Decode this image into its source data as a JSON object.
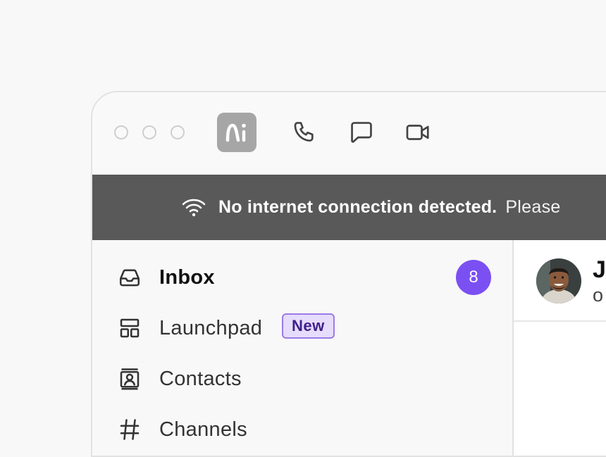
{
  "window": {
    "controls": [
      "close",
      "minimize",
      "maximize"
    ]
  },
  "toolbar": {
    "logo_icon": "app-logo",
    "icons": [
      "phone-icon",
      "chat-icon",
      "video-icon"
    ]
  },
  "banner": {
    "icon": "wifi-icon",
    "strong": "No internet connection detected.",
    "rest": "Please"
  },
  "sidebar": {
    "items": [
      {
        "label": "Inbox",
        "icon": "inbox-icon",
        "badge": "8"
      },
      {
        "label": "Launchpad",
        "icon": "launchpad-icon",
        "tag": "New"
      },
      {
        "label": "Contacts",
        "icon": "contacts-icon"
      },
      {
        "label": "Channels",
        "icon": "hash-icon"
      }
    ]
  },
  "conversation": {
    "contact_name": "J",
    "contact_status": "o"
  },
  "colors": {
    "accent": "#7b50f2",
    "banner_bg": "#595959",
    "tag_bg": "#e6dcfb",
    "tag_text": "#3f1f8a"
  }
}
